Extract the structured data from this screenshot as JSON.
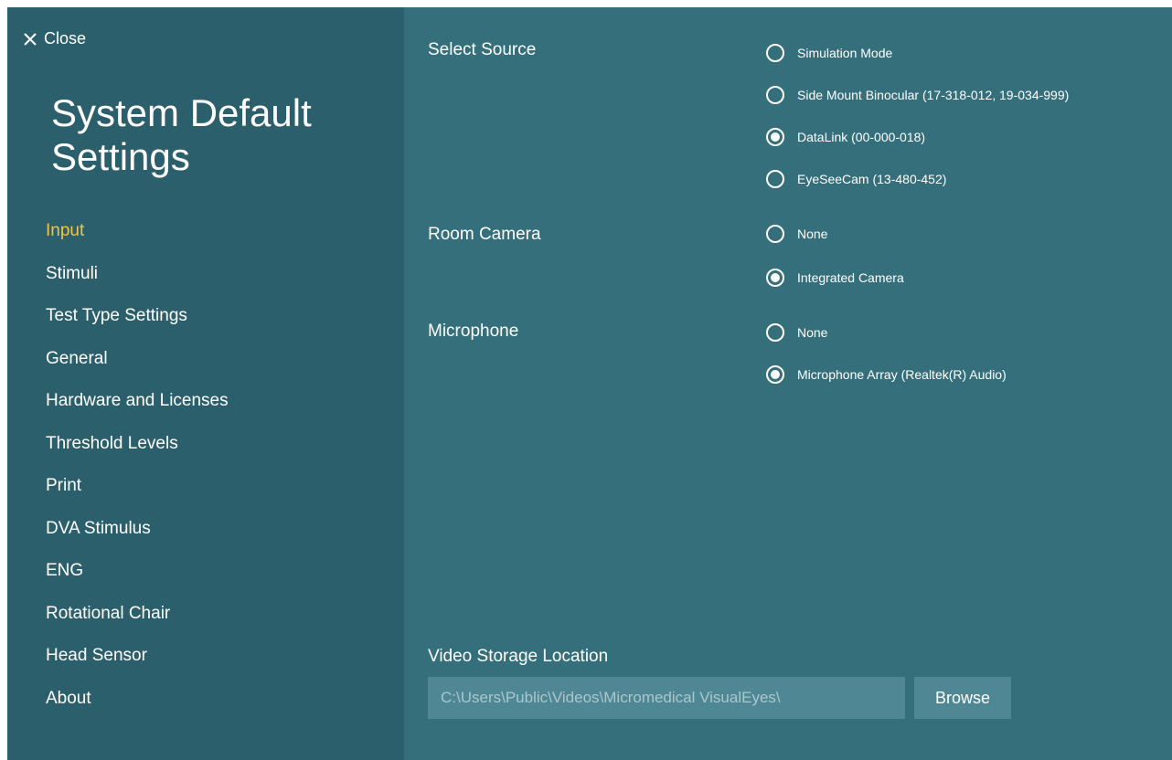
{
  "colors": {
    "sidebar_bg": "#2c5f6c",
    "main_bg": "#356f7c",
    "active_nav": "#f0c44a",
    "input_bg": "#4f8894"
  },
  "close": {
    "label": "Close",
    "icon": "close-icon"
  },
  "title": "System Default Settings",
  "nav": {
    "active": "Input",
    "items": [
      "Input",
      "Stimuli",
      "Test Type Settings",
      "General",
      "Hardware and Licenses",
      "Threshold Levels",
      "Print",
      "DVA Stimulus",
      "ENG",
      "Rotational Chair",
      "Head Sensor",
      "About"
    ]
  },
  "source": {
    "label": "Select Source",
    "selected": "DataLink  (00-000-018)",
    "options": [
      "Simulation Mode",
      "Side Mount Binocular  (17-318-012, 19-034-999)",
      "DataLink  (00-000-018)",
      "EyeSeeCam  (13-480-452)"
    ]
  },
  "room_camera": {
    "label": "Room Camera",
    "selected": "Integrated Camera",
    "options": [
      "None",
      "Integrated Camera"
    ]
  },
  "microphone": {
    "label": "Microphone",
    "selected": "Microphone Array (Realtek(R) Audio)",
    "options": [
      "None",
      "Microphone Array (Realtek(R) Audio)"
    ]
  },
  "storage": {
    "label": "Video Storage Location",
    "path": "C:\\Users\\Public\\Videos\\Micromedical VisualEyes\\",
    "browse_label": "Browse"
  }
}
